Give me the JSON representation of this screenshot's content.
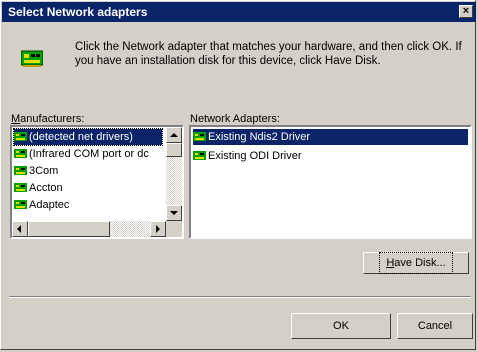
{
  "window": {
    "title": "Select Network adapters",
    "close_label": "×"
  },
  "intro_text": "Click the Network adapter that matches your hardware, and then click OK. If you have an installation disk for this device, click Have Disk.",
  "manufacturers": {
    "label_prefix": "M",
    "label_rest": "anufacturers:",
    "items": [
      "(detected net drivers)",
      "(Infrared COM port or dc",
      "3Com",
      "Accton",
      "Adaptec"
    ],
    "selected_index": 0
  },
  "adapters": {
    "label": "Network Adapters:",
    "items": [
      "Existing Ndis2 Driver",
      "Existing ODI Driver"
    ],
    "selected_index": 0
  },
  "buttons": {
    "have_disk_prefix": "H",
    "have_disk_rest": "ave Disk...",
    "ok": "OK",
    "cancel": "Cancel"
  },
  "icons": {
    "dialog": "network-card-icon",
    "item": "network-card-icon"
  },
  "colors": {
    "selection": "#0a246a",
    "face": "#d4d0c8",
    "icon_green": "#00a000",
    "icon_yellow": "#e0e000"
  }
}
